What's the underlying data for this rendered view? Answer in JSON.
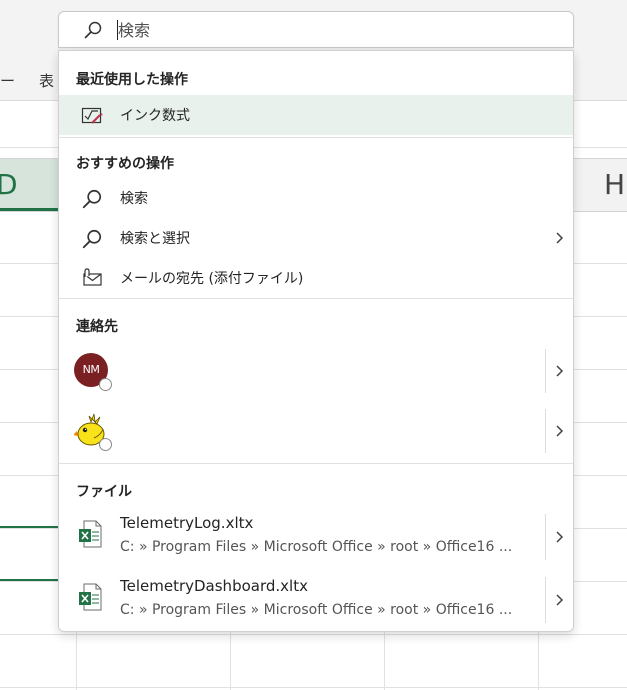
{
  "background": {
    "tabs": [
      "ー",
      "表"
    ],
    "column_left": "D",
    "column_right": "H"
  },
  "search": {
    "placeholder": "検索"
  },
  "sections": {
    "recent": "最近使用した操作",
    "suggested": "おすすめの操作",
    "contacts": "連絡先",
    "files": "ファイル"
  },
  "recent_actions": [
    {
      "label": "インク数式",
      "icon": "ink-equation-icon"
    }
  ],
  "suggested_actions": [
    {
      "label": "検索",
      "icon": "search-icon"
    },
    {
      "label": "検索と選択",
      "icon": "search-icon",
      "has_submenu": true
    },
    {
      "label": "メールの宛先 (添付ファイル)",
      "icon": "mail-attachment-icon"
    }
  ],
  "contacts": [
    {
      "initials": "NM",
      "avatar_color": "#7a1f22"
    },
    {
      "initials": "",
      "avatar_icon": "bird-avatar-icon"
    }
  ],
  "files": [
    {
      "name": "TelemetryLog.xltx",
      "path": "C: » Program Files » Microsoft Office » root » Office16 ..."
    },
    {
      "name": "TelemetryDashboard.xltx",
      "path": "C: » Program Files » Microsoft Office » root » Office16 ..."
    }
  ],
  "colors": {
    "accent_green": "#217346",
    "highlight": "#e8f1ec"
  }
}
